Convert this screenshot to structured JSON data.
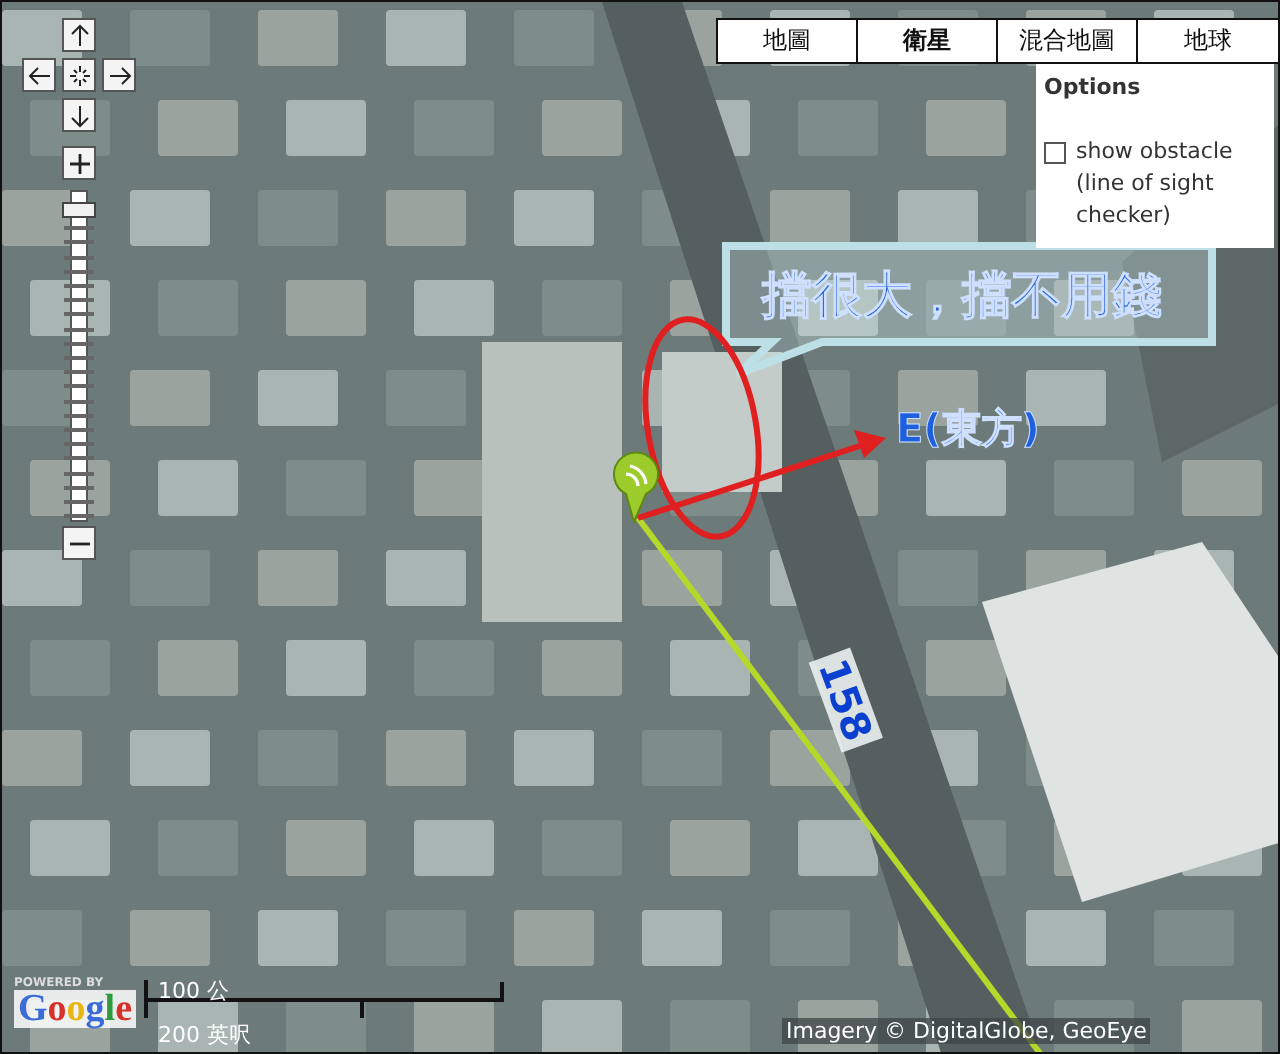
{
  "map_types": [
    {
      "label": "地圖",
      "selected": false
    },
    {
      "label": "衛星",
      "selected": true
    },
    {
      "label": "混合地圖",
      "selected": false
    },
    {
      "label": "地球",
      "selected": false
    }
  ],
  "options": {
    "title": "Options",
    "checkbox": {
      "label": "show obstacle (line of sight checker)",
      "checked": false
    }
  },
  "zoom": {
    "level": 0.97
  },
  "annotations": [
    {
      "kind": "callout",
      "text": "擋很大，擋不用錢"
    },
    {
      "kind": "arrow",
      "text": "E(東方)"
    },
    {
      "kind": "distance",
      "text": "158"
    }
  ],
  "scale": {
    "metric": "100 公",
    "imperial": "200 英呎"
  },
  "logo": {
    "powered_by": "POWERED BY",
    "name": "Google"
  },
  "attribution": "Imagery © DigitalGlobe, GeoEye"
}
